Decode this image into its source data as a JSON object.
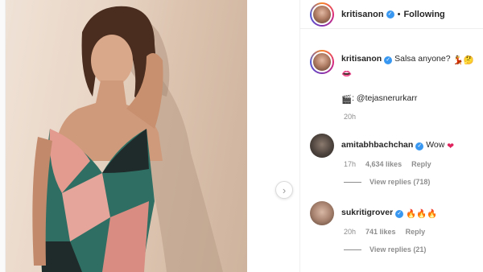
{
  "post": {
    "author": "kritisanon",
    "follow_status": "Following",
    "separator": "•"
  },
  "caption": {
    "username": "kritisanon",
    "text": "Salsa anyone?",
    "credit_handle": "@tejasnerurkarr",
    "time": "20h"
  },
  "comments": [
    {
      "username": "amitabhbachchan",
      "text": "Wow",
      "time": "17h",
      "likes": "4,634 likes",
      "reply_label": "Reply",
      "view_replies": "View replies (718)"
    },
    {
      "username": "sukritigrover",
      "text": "",
      "time": "20h",
      "likes": "741 likes",
      "reply_label": "Reply",
      "view_replies": "View replies (21)"
    }
  ],
  "icons": {
    "verified": "verified-badge-icon",
    "nav": "chevron-right-icon",
    "heart": "red-heart-icon",
    "fire": "fire-icon",
    "clapper": "clapper-board-icon",
    "lips": "lips-icon",
    "dancer": "dancer-icon",
    "thinking": "thinking-face-icon"
  },
  "colors": {
    "verified_blue": "#3897f0",
    "text_primary": "#262626",
    "text_secondary": "#8e8e8e"
  }
}
